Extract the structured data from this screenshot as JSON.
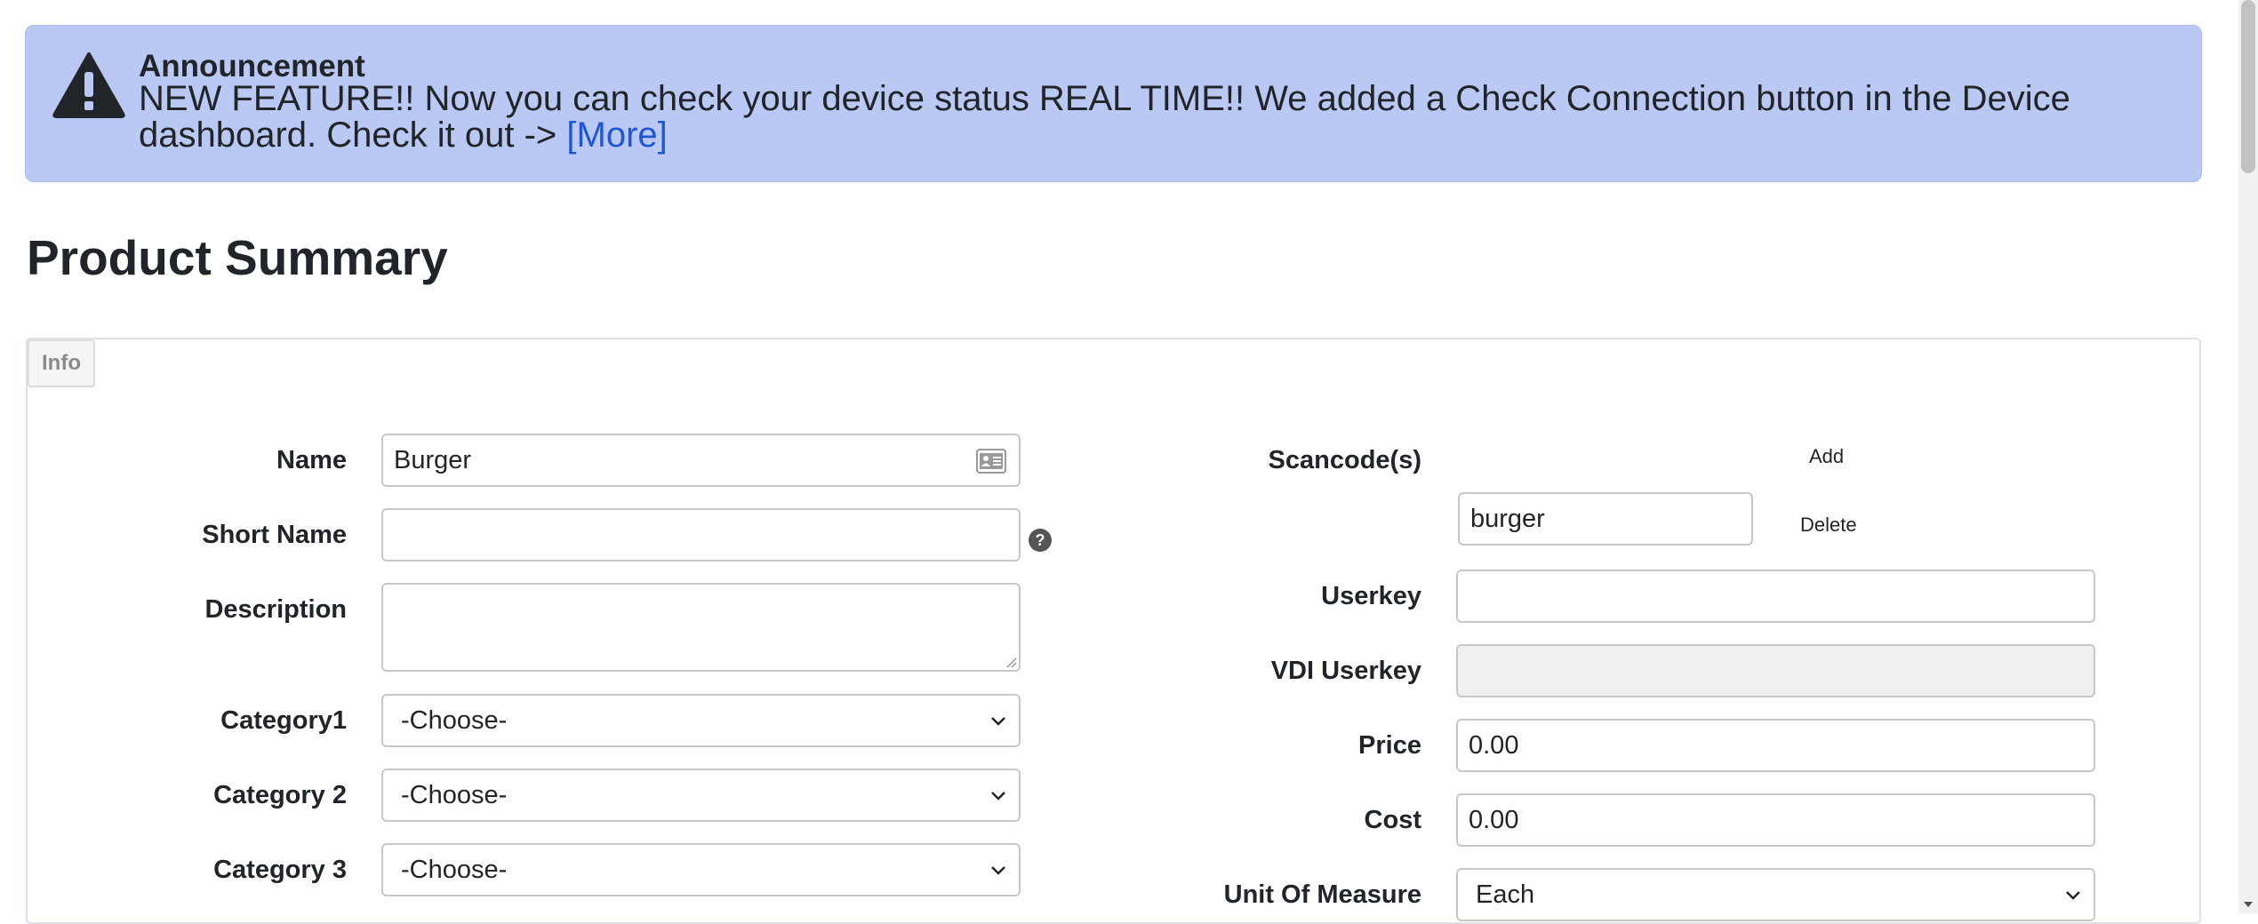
{
  "announcement": {
    "title": "Announcement",
    "text": "NEW FEATURE!! Now you can check your device status REAL TIME!! We added a Check Connection button in the Device dashboard. Check it out -> ",
    "more_link": "[More]",
    "icon": "warning-triangle-icon"
  },
  "page": {
    "title": "Product Summary"
  },
  "tabs": {
    "info": "Info"
  },
  "form_left": {
    "name": {
      "label": "Name",
      "value": "Burger"
    },
    "short_name": {
      "label": "Short Name",
      "value": ""
    },
    "description": {
      "label": "Description",
      "value": ""
    },
    "category1": {
      "label": "Category1",
      "value": "-Choose-"
    },
    "category2": {
      "label": "Category 2",
      "value": "-Choose-"
    },
    "category3": {
      "label": "Category 3",
      "value": "-Choose-"
    }
  },
  "form_right": {
    "scancodes": {
      "label": "Scancode(s)",
      "add": "Add",
      "items": [
        {
          "value": "burger",
          "delete": "Delete"
        }
      ]
    },
    "userkey": {
      "label": "Userkey",
      "value": ""
    },
    "vdi_userkey": {
      "label": "VDI Userkey",
      "value": ""
    },
    "price": {
      "label": "Price",
      "value": "0.00"
    },
    "cost": {
      "label": "Cost",
      "value": "0.00"
    },
    "unit_of_measure": {
      "label": "Unit Of Measure",
      "value": "Each"
    }
  },
  "colors": {
    "announcement_bg": "#bac9f3",
    "link": "#1f56d6"
  }
}
